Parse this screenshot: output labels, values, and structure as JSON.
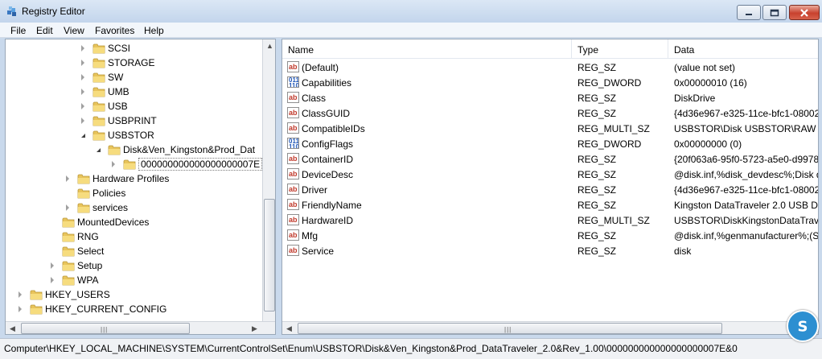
{
  "window": {
    "title": "Registry Editor",
    "buttons": {
      "minimize": "minimize-icon",
      "maximize": "maximize-icon",
      "close": "close-icon"
    }
  },
  "menu": [
    "File",
    "Edit",
    "View",
    "Favorites",
    "Help"
  ],
  "tree": [
    {
      "label": "SCSI",
      "state": "collapsed"
    },
    {
      "label": "STORAGE",
      "state": "collapsed"
    },
    {
      "label": "SW",
      "state": "collapsed"
    },
    {
      "label": "UMB",
      "state": "collapsed"
    },
    {
      "label": "USB",
      "state": "collapsed"
    },
    {
      "label": "USBPRINT",
      "state": "collapsed"
    },
    {
      "label": "USBSTOR",
      "state": "expanded"
    },
    {
      "label": "Disk&Ven_Kingston&Prod_Dat",
      "state": "expanded"
    },
    {
      "label": "000000000000000000007E",
      "state": "collapsed",
      "selected": true
    },
    {
      "label": "Hardware Profiles",
      "state": "collapsed"
    },
    {
      "label": "Policies",
      "state": "none"
    },
    {
      "label": "services",
      "state": "collapsed"
    },
    {
      "label": "MountedDevices",
      "state": "none"
    },
    {
      "label": "RNG",
      "state": "none"
    },
    {
      "label": "Select",
      "state": "none"
    },
    {
      "label": "Setup",
      "state": "collapsed"
    },
    {
      "label": "WPA",
      "state": "collapsed"
    },
    {
      "label": "HKEY_USERS",
      "state": "collapsed"
    },
    {
      "label": "HKEY_CURRENT_CONFIG",
      "state": "collapsed"
    }
  ],
  "columns": [
    "Name",
    "Type",
    "Data"
  ],
  "values": [
    {
      "name": "(Default)",
      "type": "REG_SZ",
      "data": "(value not set)",
      "icon": "string-value-icon"
    },
    {
      "name": "Capabilities",
      "type": "REG_DWORD",
      "data": "0x00000010 (16)",
      "icon": "dword-value-icon"
    },
    {
      "name": "Class",
      "type": "REG_SZ",
      "data": "DiskDrive",
      "icon": "string-value-icon"
    },
    {
      "name": "ClassGUID",
      "type": "REG_SZ",
      "data": "{4d36e967-e325-11ce-bfc1-08002",
      "icon": "string-value-icon"
    },
    {
      "name": "CompatibleIDs",
      "type": "REG_MULTI_SZ",
      "data": "USBSTOR\\Disk USBSTOR\\RAW",
      "icon": "string-value-icon"
    },
    {
      "name": "ConfigFlags",
      "type": "REG_DWORD",
      "data": "0x00000000 (0)",
      "icon": "dword-value-icon"
    },
    {
      "name": "ContainerID",
      "type": "REG_SZ",
      "data": "{20f063a6-95f0-5723-a5e0-d99781",
      "icon": "string-value-icon"
    },
    {
      "name": "DeviceDesc",
      "type": "REG_SZ",
      "data": "@disk.inf,%disk_devdesc%;Disk d",
      "icon": "string-value-icon"
    },
    {
      "name": "Driver",
      "type": "REG_SZ",
      "data": "{4d36e967-e325-11ce-bfc1-08002",
      "icon": "string-value-icon"
    },
    {
      "name": "FriendlyName",
      "type": "REG_SZ",
      "data": "Kingston DataTraveler 2.0 USB De",
      "icon": "string-value-icon"
    },
    {
      "name": "HardwareID",
      "type": "REG_MULTI_SZ",
      "data": "USBSTOR\\DiskKingstonDataTrave",
      "icon": "string-value-icon"
    },
    {
      "name": "Mfg",
      "type": "REG_SZ",
      "data": "@disk.inf,%genmanufacturer%;(S",
      "icon": "string-value-icon"
    },
    {
      "name": "Service",
      "type": "REG_SZ",
      "data": "disk",
      "icon": "string-value-icon"
    }
  ],
  "status": {
    "path": "Computer\\HKEY_LOCAL_MACHINE\\SYSTEM\\CurrentControlSet\\Enum\\USBSTOR\\Disk&Ven_Kingston&Prod_DataTraveler_2.0&Rev_1.00\\000000000000000000007E&0"
  },
  "icons": {
    "string": "ab",
    "dword": "011\n110"
  }
}
